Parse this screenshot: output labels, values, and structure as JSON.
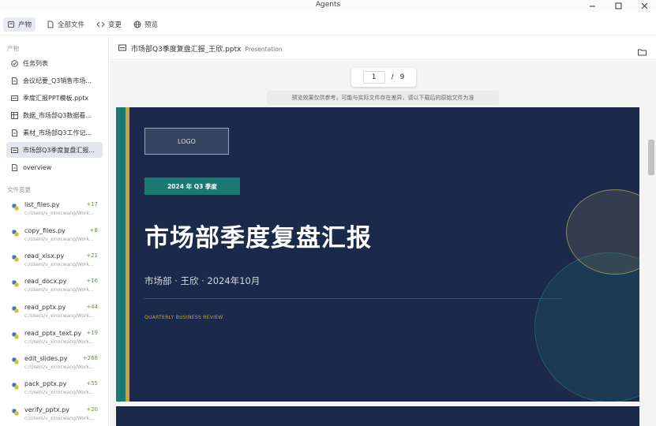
{
  "window": {
    "title": "Agents"
  },
  "top_tabs": [
    {
      "label": "产物",
      "icon": "box-icon"
    },
    {
      "label": "全部文件",
      "icon": "file-icon"
    },
    {
      "label": "变更",
      "icon": "code-icon"
    },
    {
      "label": "预览",
      "icon": "globe-icon"
    }
  ],
  "sidebar": {
    "artifacts_label": "产物",
    "items": [
      {
        "label": "任务列表",
        "icon": "check-circle-icon"
      },
      {
        "label": "会议纪要_Q3销售市场...",
        "icon": "document-icon"
      },
      {
        "label": "季度汇报PPT模板.pptx",
        "icon": "presentation-icon"
      },
      {
        "label": "数据_市场部Q3数据看...",
        "icon": "table-icon"
      },
      {
        "label": "素材_市场部Q3工作记...",
        "icon": "document-icon"
      },
      {
        "label": "市场部Q3季度复盘汇报...",
        "icon": "presentation-icon"
      },
      {
        "label": "overview",
        "icon": "document-icon"
      }
    ],
    "changes_label": "文件变更",
    "changes": [
      {
        "name": "list_files.py",
        "added": "+17",
        "path": "c:/Users/v_xinocwang/Work..."
      },
      {
        "name": "copy_files.py",
        "added": "+8",
        "path": "c:/Users/v_xinocwang/Work..."
      },
      {
        "name": "read_xlsx.py",
        "added": "+21",
        "path": "c:/Users/v_xinocwang/Work..."
      },
      {
        "name": "read_docx.py",
        "added": "+16",
        "path": "c:/Users/v_xinocwang/Work..."
      },
      {
        "name": "read_pptx.py",
        "added": "+44",
        "path": "c:/Users/v_xinocwang/Work..."
      },
      {
        "name": "read_pptx_text.py",
        "added": "+19",
        "path": "c:/Users/v_xinocwang/Work..."
      },
      {
        "name": "edit_slides.py",
        "added": "+268",
        "path": "c:/Users/v_xinocwang/Work..."
      },
      {
        "name": "pack_pptx.py",
        "added": "+55",
        "path": "c:/Users/v_xinocwang/Work..."
      },
      {
        "name": "verify_pptx.py",
        "added": "+20",
        "path": "c:/Users/v_xinocwang/Work..."
      }
    ]
  },
  "file_header": {
    "name": "市场部Q3季度复盘汇报_王欣.pptx",
    "kind": "Presentation"
  },
  "pager": {
    "current": "1",
    "separator": "/",
    "total": "9"
  },
  "notice": "预览效果仅供参考，可能与实际文件存在差异，请以下载后的原始文件为准",
  "slide": {
    "logo": "LOGO",
    "badge": "2024 年 Q3 季度",
    "title": "市场部季度复盘汇报",
    "subtitle": "市场部 · 王欣 · 2024年10月",
    "english": "QUARTERLY BUSINESS REVIEW"
  },
  "colors": {
    "slide_bg": "#1b2a4b",
    "teal": "#1a7a73",
    "gold": "#c9a43a",
    "added_green": "#5a9e3a",
    "selected_bg": "#e4e7ee"
  }
}
